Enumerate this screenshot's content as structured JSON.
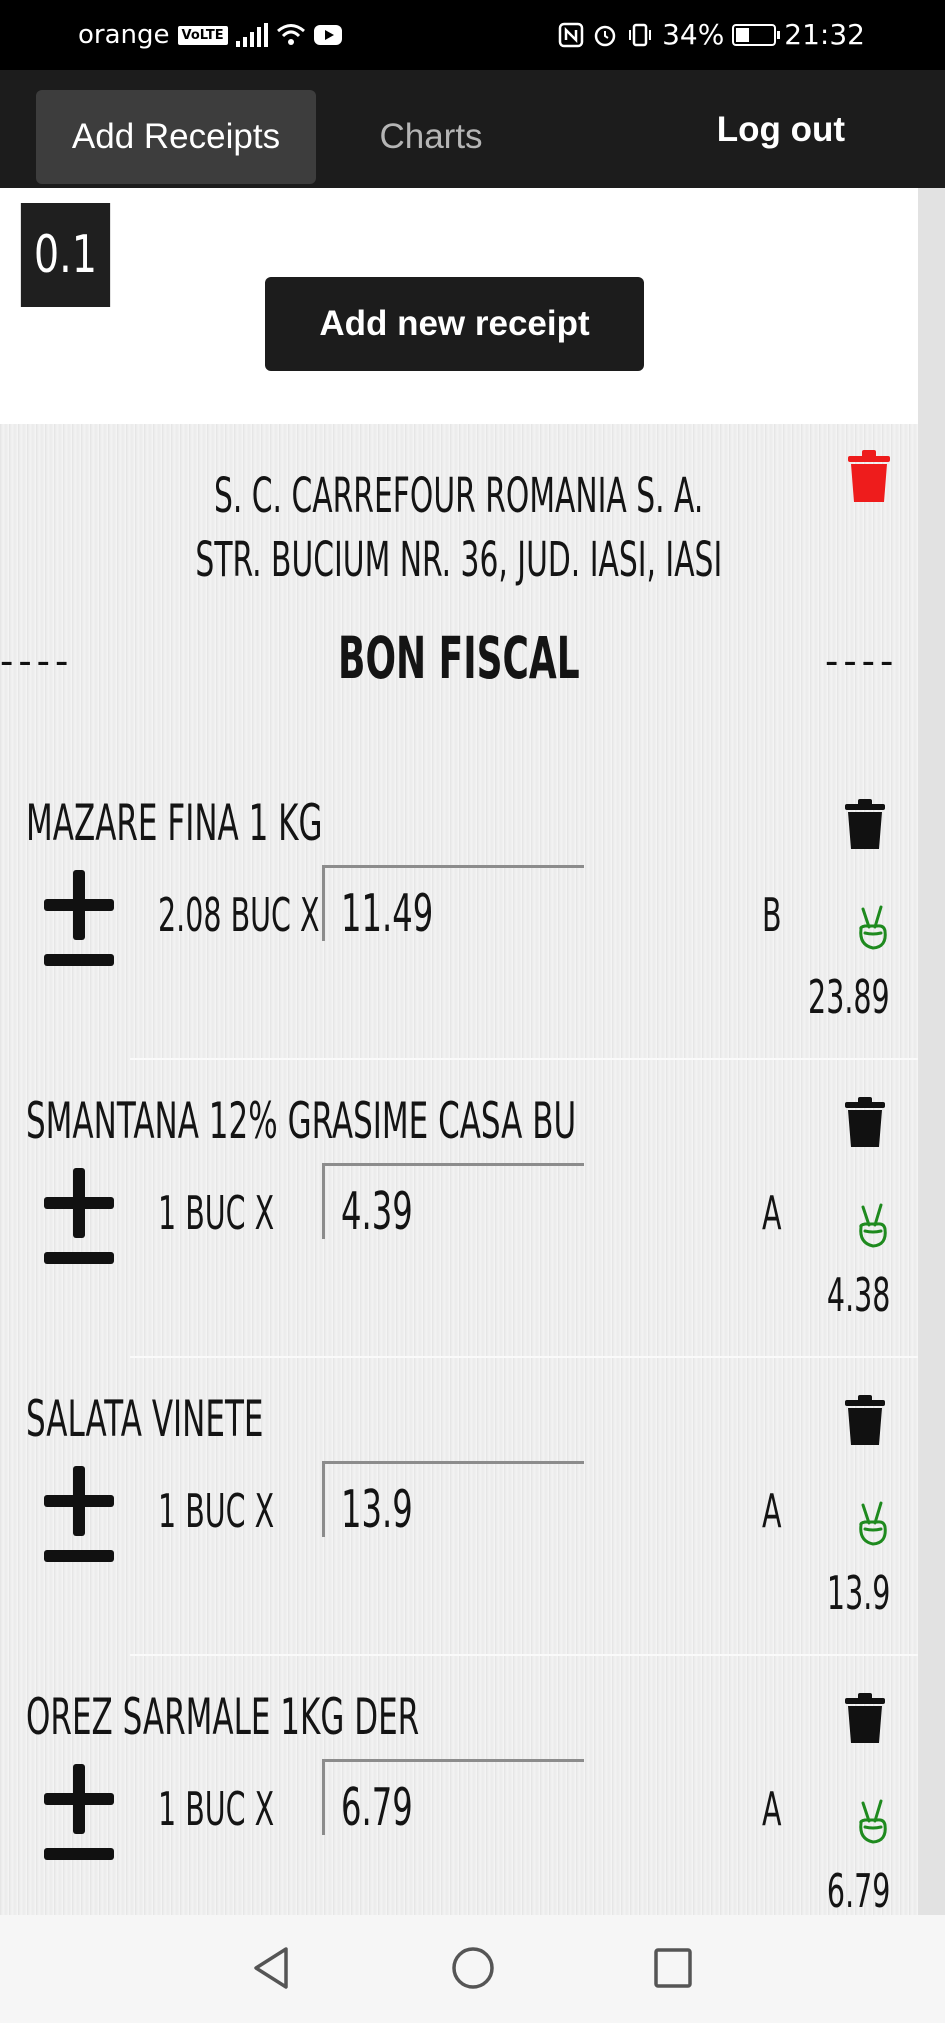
{
  "status_bar": {
    "carrier": "orange",
    "volte": "VoLTE",
    "battery": "34%",
    "time": "21:32"
  },
  "nav": {
    "add_receipts": "Add Receipts",
    "charts": "Charts",
    "logout": "Log out"
  },
  "badge": "0.1",
  "add_button": "Add new receipt",
  "receipt": {
    "store_line1": "S. C. CARREFOUR ROMANIA S. A.",
    "store_line2": "STR. BUCIUM NR. 36, JUD. IASI, IASI",
    "title": "BON FISCAL",
    "dashes": "----",
    "items": [
      {
        "name": "MAZARE FINA 1 KG",
        "qty": "2.08 BUC X",
        "price": "11.49",
        "tax": "B",
        "total": "23.89"
      },
      {
        "name": "SMANTANA 12% GRASIME CASA BU",
        "qty": "1 BUC X",
        "price": "4.39",
        "tax": "A",
        "total": "4.38"
      },
      {
        "name": "SALATA VINETE",
        "qty": "1 BUC X",
        "price": "13.9",
        "tax": "A",
        "total": "13.9"
      },
      {
        "name": "OREZ SARMALE 1KG DER",
        "qty": "1 BUC X",
        "price": "6.79",
        "tax": "A",
        "total": "6.79"
      }
    ]
  },
  "colors": {
    "accent_delete": "#ee1c1c",
    "check_green": "#1e8a1e",
    "nav_bg": "#1c1c1c"
  }
}
